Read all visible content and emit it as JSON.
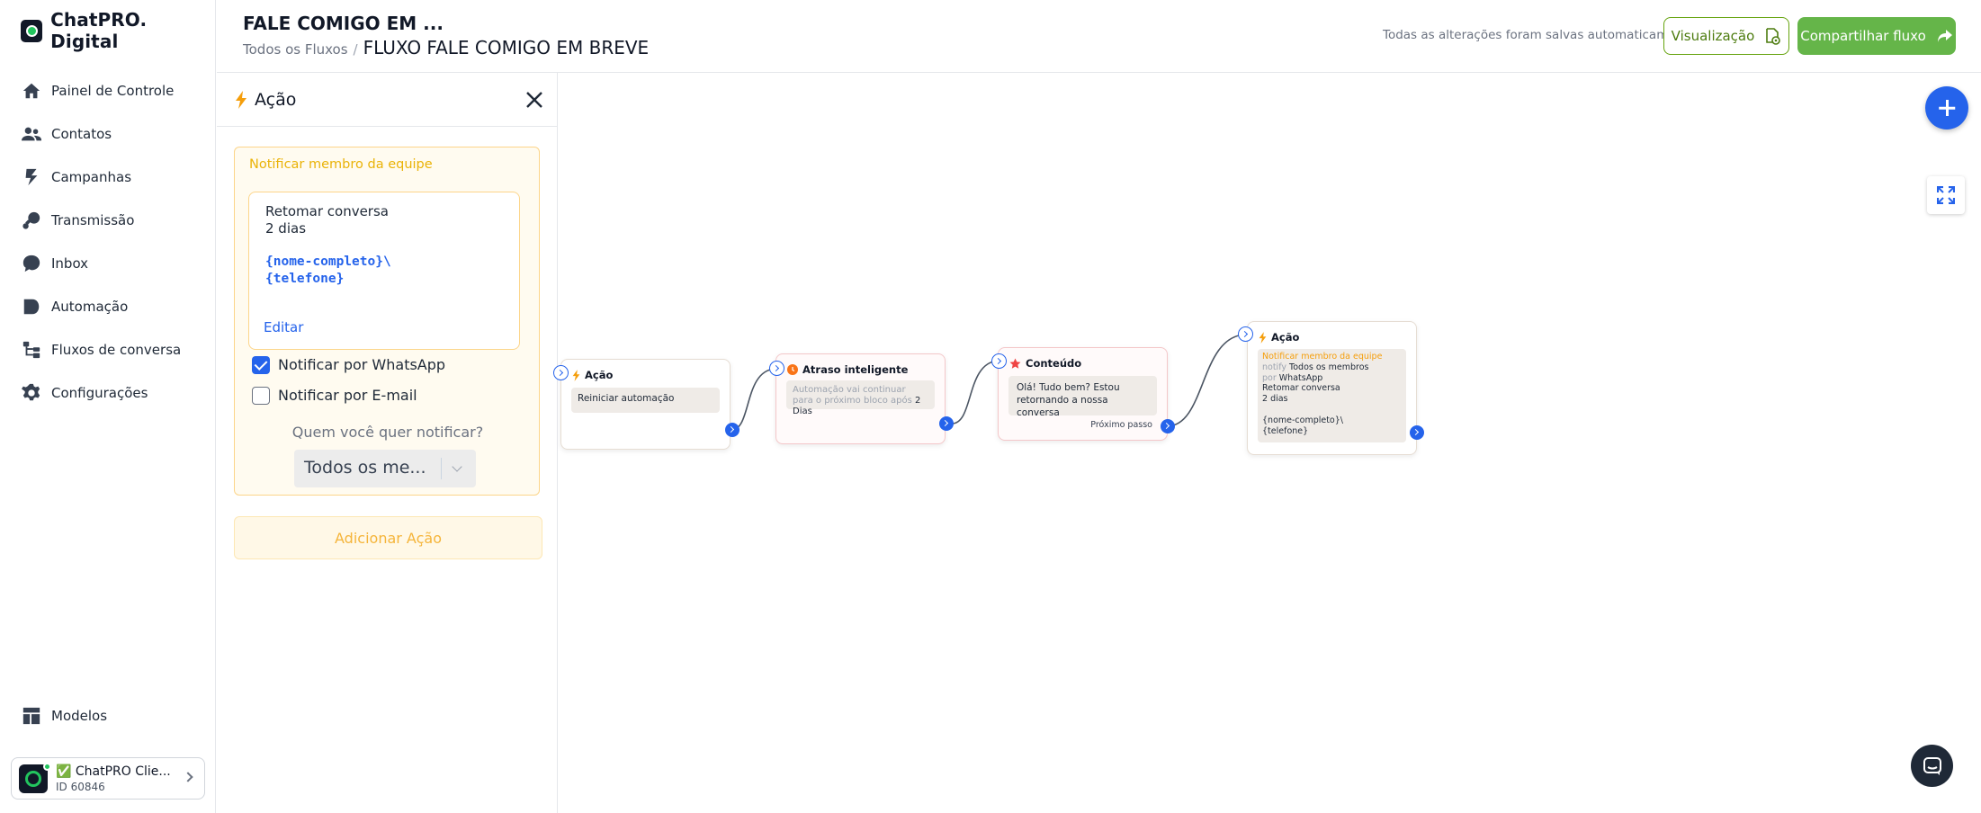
{
  "brand": {
    "name": "ChatPRO. Digital"
  },
  "sidebar": {
    "items": [
      {
        "label": "Painel de Controle",
        "icon": "home-icon"
      },
      {
        "label": "Contatos",
        "icon": "users-icon"
      },
      {
        "label": "Campanhas",
        "icon": "megaphone-icon"
      },
      {
        "label": "Transmissão",
        "icon": "broadcast-icon"
      },
      {
        "label": "Inbox",
        "icon": "chat-bubble-icon"
      },
      {
        "label": "Automação",
        "icon": "automation-icon"
      },
      {
        "label": "Fluxos de conversa",
        "icon": "flow-icon"
      },
      {
        "label": "Configurações",
        "icon": "gear-icon"
      }
    ],
    "bottom_item": {
      "label": "Modelos",
      "icon": "templates-icon"
    },
    "account": {
      "name": "✅ ChatPRO Clie...",
      "id": "ID 60846"
    }
  },
  "header": {
    "title": "FALE COMIGO EM ...",
    "breadcrumb_root": "Todos os Fluxos",
    "breadcrumb_current": "FLUXO FALE COMIGO EM BREVE",
    "saved_status": "Todas as alterações foram salvas automaticamente",
    "preview_label": "Visualização",
    "share_label": "Compartilhar fluxo"
  },
  "panel": {
    "title": "Ação",
    "notify_label": "Notificar membro da equipe",
    "message_lines": [
      "Retomar conversa",
      "2 dias"
    ],
    "message_vars": [
      "{nome-completo}\\",
      "{telefone}"
    ],
    "edit_label": "Editar",
    "notify_whatsapp": {
      "label": "Notificar por WhatsApp",
      "checked": true
    },
    "notify_email": {
      "label": "Notificar por E-mail",
      "checked": false
    },
    "who_label": "Quem você quer notificar?",
    "who_value": "Todos os me...",
    "add_action_label": "Adicionar Ação"
  },
  "canvas": {
    "nodes": [
      {
        "type": "Ação",
        "body": "Reiniciar automação"
      },
      {
        "type": "Atraso inteligente",
        "body_muted": "Automação vai continuar para o próximo bloco após",
        "body_value": "2 Dias"
      },
      {
        "type": "Conteúdo",
        "body": "Olá! Tudo bem? Estou retornando a nossa conversa",
        "footer": "Próximo passo"
      },
      {
        "type": "Ação",
        "label_notify": "Notificar membro da equipe",
        "notify_word": "notify",
        "notify_who": "Todos os membros",
        "por_word": "por",
        "channel": "WhatsApp",
        "lines": [
          "Retomar conversa",
          "2 dias",
          "",
          "{nome-completo}\\",
          "{telefone}"
        ]
      }
    ]
  },
  "colors": {
    "accent": "#2563eb",
    "brand_green": "#65b549",
    "warning": "#f5b53b"
  }
}
